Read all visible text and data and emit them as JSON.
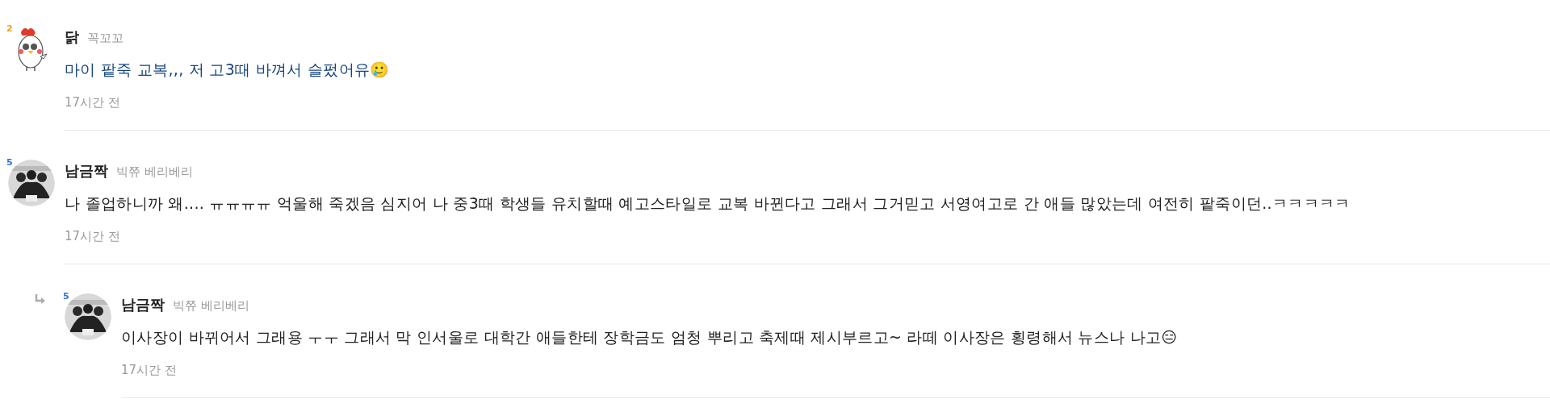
{
  "comments": [
    {
      "kind": "chicken",
      "level": "2",
      "color": "#f0a020",
      "author": "닭",
      "nickname": "꼭꼬꼬",
      "text": "마이 팥죽 교복,,, 저 고3때 바껴서 슬펐어유🥲",
      "highlighted": true,
      "time": "17시간 전"
    },
    {
      "kind": "picture",
      "level": "5",
      "color": "#2f6fe0",
      "author": "남금짝",
      "nickname": "빅쮸 베리베리",
      "text": "나 졸업하니까 왜.... ㅠㅠㅠㅠ 억울해 죽겠음 심지어 나 중3때 학생들 유치할때 예고스타일로 교복 바뀐다고 그래서 그거믿고 서영여고로 간 애들 많았는데 여전히 팥죽이던..ㅋㅋㅋㅋㅋ",
      "highlighted": false,
      "time": "17시간 전",
      "children": [
        {
          "kind": "picture",
          "level": "5",
          "color": "#2f6fe0",
          "author": "남금짝",
          "nickname": "빅쮸 베리베리",
          "text": "이사장이 바뀌어서 그래용 ㅜㅜ 그래서 막 인서울로 대학간 애들한테 장학금도 엄청 뿌리고 축제때 제시부르고~ 라떼 이사장은 횡령해서 뉴스나 나고😑",
          "highlighted": false,
          "time": "17시간 전"
        }
      ]
    }
  ]
}
